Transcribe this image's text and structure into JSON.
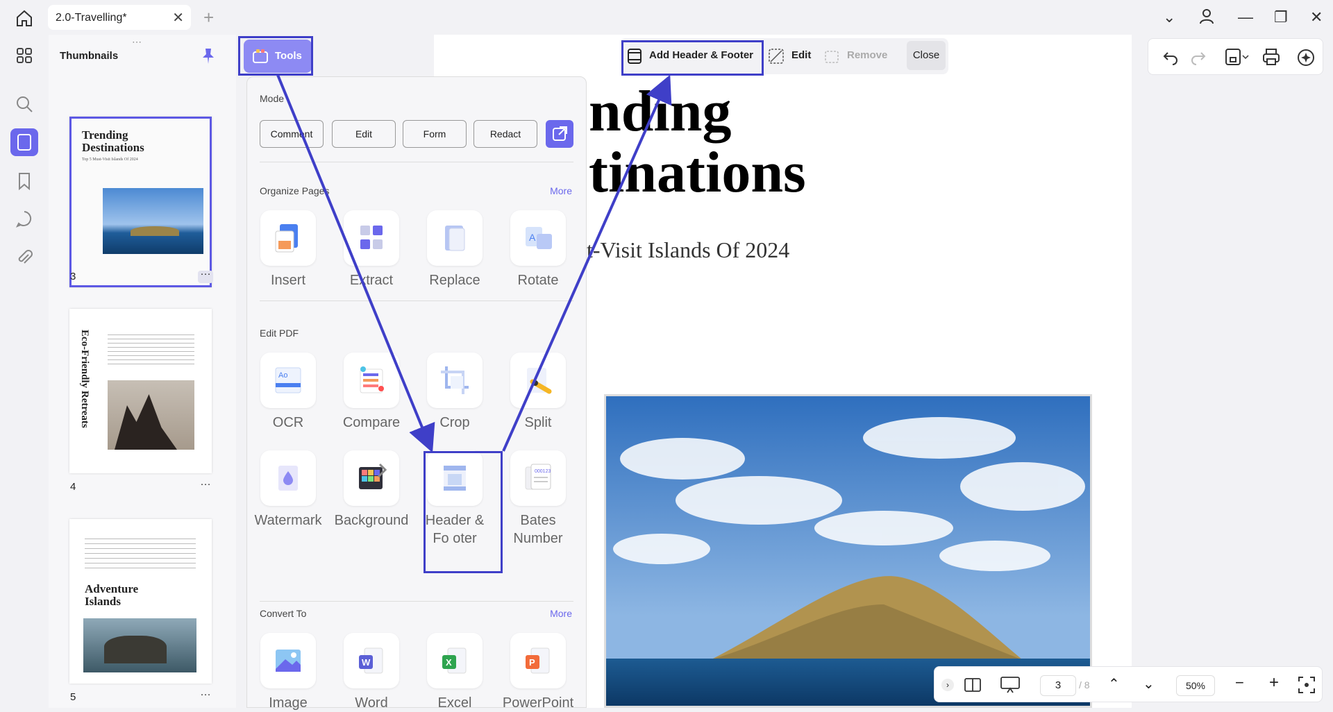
{
  "titlebar": {
    "tab_title": "2.0-Travelling*",
    "tab_close": "✕",
    "new_tab": "+"
  },
  "window": {
    "dropdown": "⌄",
    "minimize": "—",
    "restore": "❐",
    "close": "✕"
  },
  "thumbnails": {
    "title": "Thumbnails",
    "pages": [
      {
        "number": "3",
        "title_line1": "Trending",
        "title_line2": "Destinations",
        "subtitle": "Top 5 Must-Visit Islands Of 2024"
      },
      {
        "number": "4",
        "vertical_title": "Eco-Friendly Retreats"
      },
      {
        "number": "5",
        "title_line1": "Adventure",
        "title_line2": "Islands"
      }
    ],
    "dots": "···"
  },
  "tools_button": {
    "label": "Tools"
  },
  "panel": {
    "mode_label": "Mode",
    "mode_buttons": [
      "Comment",
      "Edit",
      "Form",
      "Redact"
    ],
    "organize_label": "Organize Pages",
    "organize_more": "More",
    "organize_tools": [
      "Insert",
      "Extract",
      "Replace",
      "Rotate"
    ],
    "edit_label": "Edit PDF",
    "edit_tools": [
      "OCR",
      "Compare",
      "Crop",
      "Split",
      "Watermark",
      "Background",
      "Header & Fo oter",
      "Bates Number"
    ],
    "convert_label": "Convert To",
    "convert_more": "More",
    "convert_tools": [
      "Image",
      "Word",
      "Excel",
      "PowerPoint"
    ]
  },
  "header_toolbar": {
    "add": "Add Header & Footer",
    "edit": "Edit",
    "remove": "Remove",
    "close": "Close"
  },
  "document": {
    "title_line1": "nding",
    "title_line2": "tinations",
    "subtitle": "t-Visit Islands Of 2024"
  },
  "bottom": {
    "page": "3",
    "total": "/ 8",
    "zoom": "50%"
  },
  "colors": {
    "accent": "#6b68ec",
    "highlight": "#3f3fc8"
  }
}
